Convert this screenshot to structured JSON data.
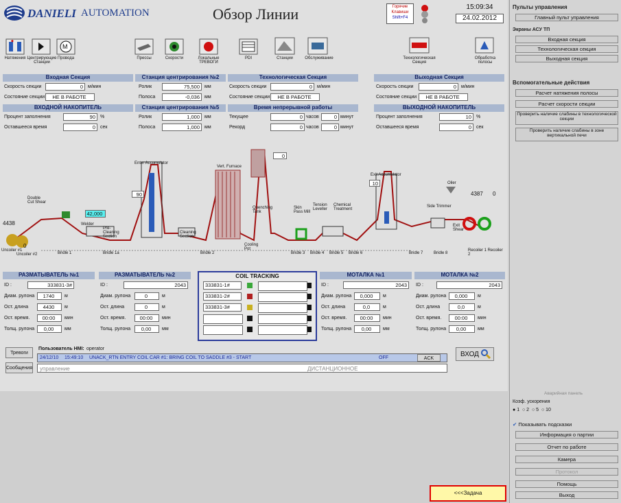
{
  "header": {
    "brand": "DANIELI",
    "brand_sub": "AUTOMATION",
    "title": "Обзор Линии",
    "hotkey_line1": "Горячие",
    "hotkey_line2": "Клавиши",
    "hotkey_line3": "Shift+F4",
    "time": "15:09:34",
    "date": "24.02.2012"
  },
  "toolbar": [
    {
      "name": "tension",
      "label": "Натяжения"
    },
    {
      "name": "centering",
      "label": "Центрирующие Станции"
    },
    {
      "name": "wires",
      "label": "Провода"
    },
    {
      "name": "presses",
      "label": "Прессы"
    },
    {
      "name": "speeds",
      "label": "Скорости"
    },
    {
      "name": "local-alarms",
      "label": "Локальные ТРЕВОГИ"
    },
    {
      "name": "pdi",
      "label": "PDI"
    },
    {
      "name": "stations",
      "label": "Станции"
    },
    {
      "name": "service",
      "label": "Обслуживание"
    },
    {
      "name": "tech-section",
      "label": "Технологическая Секция"
    },
    {
      "name": "strip-processing",
      "label": "Обработка полосы"
    }
  ],
  "entry": {
    "title": "Входная Секция",
    "speed_label": "Скорость секции",
    "speed_value": "0",
    "speed_unit": "м/мин",
    "state_label": "Состояние секции",
    "state_value": "НЕ В РАБОТЕ",
    "acc_title": "ВХОДНОЙ НАКОПИТЕЛЬ",
    "fill_label": "Процент заполнения",
    "fill_value": "90",
    "fill_unit": "%",
    "remain_label": "Оставшееся время",
    "remain_value": "0",
    "remain_unit": "сек"
  },
  "centering2": {
    "title": "Станция центрирования №2",
    "roll_label": "Ролик",
    "roll_value": "75,500",
    "roll_unit": "мм",
    "strip_label": "Полоса",
    "strip_value": "-0,036",
    "strip_unit": "мм"
  },
  "centering5": {
    "title": "Станция центрирования №5",
    "roll_label": "Ролик",
    "roll_value": "1,000",
    "roll_unit": "мм",
    "strip_label": "Полоса",
    "strip_value": "1,000",
    "strip_unit": "мм"
  },
  "tech": {
    "title": "Технологическая Секция",
    "speed_label": "Скорость секции",
    "speed_value": "0",
    "speed_unit": "м/мин",
    "state_label": "Состояние секции",
    "state_value": "НЕ В РАБОТЕ",
    "cont_title": "Время непрерывной работы",
    "cur_label": "Текущее",
    "cur_h": "0",
    "cur_h_unit": "часов",
    "cur_m": "0",
    "cur_m_unit": "минут",
    "rec_label": "Рекорд",
    "rec_h": "0",
    "rec_h_unit": "часов",
    "rec_m": "0",
    "rec_m_unit": "минут"
  },
  "exit": {
    "title": "Выходная Секция",
    "speed_label": "Скорость секции",
    "speed_value": "0",
    "speed_unit": "м/мин",
    "state_label": "Состояние секции",
    "state_value": "НЕ В РАБОТЕ",
    "acc_title": "ВЫХОДНОЙ НАКОПИТЕЛЬ",
    "fill_label": "Процент заполнения",
    "fill_value": "10",
    "fill_unit": "%",
    "remain_label": "Оставшееся время",
    "remain_value": "0",
    "remain_unit": "сек"
  },
  "diagram": {
    "val_4438": "4438",
    "val_42000": "42,000",
    "val_90": "90",
    "val_0a": "0",
    "val_10": "10",
    "val_4387": "4387",
    "val_0b": "0",
    "val_0c": "0",
    "lbl_entry_acc": "Enter Accumulator",
    "lbl_vert_furnace": "Vert. Furnace",
    "lbl_exit_acc": "Exit Accumulator",
    "lbl_double_cut": "Double Cut Shear",
    "lbl_welder": "Welder",
    "lbl_preclean": "Pre-Cleaning Section",
    "lbl_cleaning": "Cleaning Section",
    "lbl_quench": "Quenching Tank",
    "lbl_cooling": "Cooling Pot",
    "lbl_skin": "Skin Pass Mill",
    "lbl_tension_lev": "Tension Leveller",
    "lbl_chemical": "Chemical Treatment",
    "lbl_side_trimmer": "Side Trimmer",
    "lbl_oiler": "Oiler",
    "lbl_exit_shear": "Exit Shear",
    "lbl_uncoiler1": "Uncoiler #1",
    "lbl_uncoiler2": "Uncoiler #2",
    "lbl_recoiler": "Recoiler 1 Recoiler 2",
    "bridles": [
      "Bridle 1",
      "Bridle 1a",
      "Bridle 2",
      "Bridle 3",
      "Bridle 4",
      "Bridle 5",
      "Bridle 6",
      "Bridle 7",
      "Bridle 8"
    ]
  },
  "uncoiler1": {
    "title": "РАЗМАТЫВАТЕЛЬ №1",
    "id_label": "ID :",
    "id_value": "333831-3#",
    "diam_label": "Диам. рулона",
    "diam_value": "1740",
    "diam_unit": "м",
    "len_label": "Ост. длина",
    "len_value": "4430",
    "len_unit": "м",
    "time_label": "Ост. время.",
    "time_value": "00:00",
    "time_unit": "мин",
    "thick_label": "Толщ. рулона",
    "thick_value": "0,00",
    "thick_unit": "мм"
  },
  "uncoiler2": {
    "title": "РАЗМАТЫВАТЕЛЬ №2",
    "id_label": "ID :",
    "id_value": "2043",
    "diam_label": "Диам. рулона",
    "diam_value": "0",
    "diam_unit": "м",
    "len_label": "Ост. длина",
    "len_value": "0",
    "len_unit": "м",
    "time_label": "Ост. время.",
    "time_value": "00:00",
    "time_unit": "мин",
    "thick_label": "Толщ. рулона",
    "thick_value": "0,00",
    "thick_unit": "мм"
  },
  "tracking": {
    "title": "COIL TRACKING",
    "rows": [
      {
        "id": "333831-1#",
        "color": "#3aa83a"
      },
      {
        "id": "333831-2#",
        "color": "#b02020"
      },
      {
        "id": "333831-3#",
        "color": "#c8b020"
      },
      {
        "id": "",
        "color": "#111111"
      },
      {
        "id": "",
        "color": "#111111"
      }
    ]
  },
  "recoiler1": {
    "title": "МОТАЛКА №1",
    "id_label": "ID :",
    "id_value": "2043",
    "diam_label": "Диам. рулона",
    "diam_value": "0,000",
    "diam_unit": "м",
    "len_label": "Ост. длина",
    "len_value": "0,0",
    "len_unit": "м",
    "time_label": "Ост. время.",
    "time_value": "00:00",
    "time_unit": "мин",
    "thick_label": "Толщ. рулона",
    "thick_value": "0,00",
    "thick_unit": "мм"
  },
  "recoiler2": {
    "title": "МОТАЛКА №2",
    "id_label": "ID :",
    "id_value": "2043",
    "diam_label": "Диам. рулона",
    "diam_value": "0,000",
    "diam_unit": "м",
    "len_label": "Ост. длина",
    "len_value": "0,0",
    "len_unit": "м",
    "time_label": "Ост. время.",
    "time_value": "00:00",
    "time_unit": "мин",
    "thick_label": "Толщ. рулона",
    "thick_value": "0,00",
    "thick_unit": "мм"
  },
  "alarm": {
    "btn_alarms": "Тревоги",
    "btn_messages": "Сообщения",
    "user_label": "Пользователь HMI:",
    "user_value": "operator",
    "msg_date": "24/12/10",
    "msg_time": "15:49:10",
    "msg_text": "UNACK_RTN ENTRY COIL CAR #1: BRING COIL TO SADDLE #3 - START",
    "msg_state": "OFF",
    "ack": "ACK",
    "status_left": "управление",
    "status_right": "ДИСТАНЦИОННОЕ",
    "login": "ВХОД"
  },
  "task_button": "<<<Задача",
  "sidebar": {
    "sec1_title": "Пульты управления",
    "sec1_items": [
      "Главный пульт управления"
    ],
    "sec2_title": "Экраны АСУ ТП",
    "sec2_items": [
      "Входная секция",
      "Технологическая секция",
      "Выходная секция"
    ],
    "sec3_title": "Вспомогательные действия",
    "sec3_items": [
      "Расчет натяжения полосы",
      "Расчет скорости секции",
      "Проверить наличие слабины в технологической секции",
      "Проверить наличие слабины в зоне вертикальной печи"
    ],
    "aux_panel": "Аварийная панель",
    "accel_label": "Коэф. ускорения",
    "accel_options": [
      "1",
      "2",
      "5",
      "10"
    ],
    "hints": "Показывать подсказки",
    "bottom_items": [
      "Информация о партии",
      "Отчет по работе",
      "Камера",
      "Протокол",
      "Помощь",
      "Выход"
    ]
  }
}
